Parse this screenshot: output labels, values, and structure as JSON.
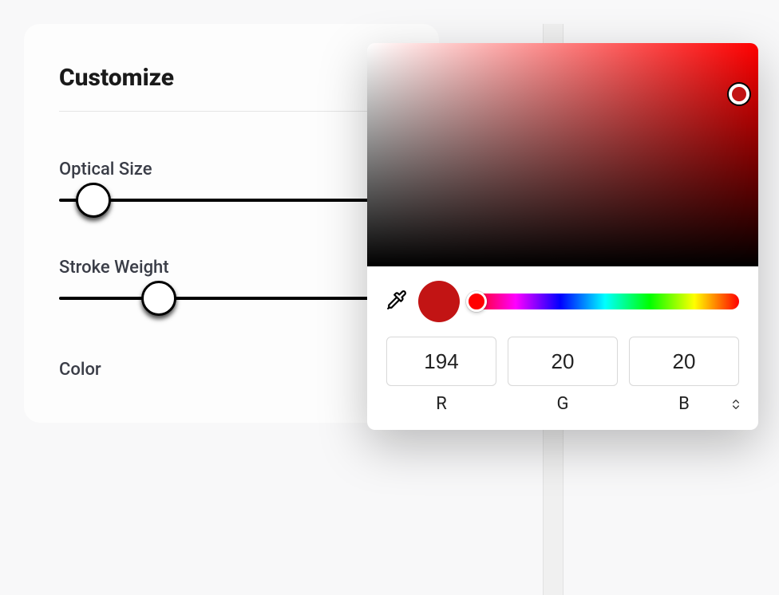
{
  "panel": {
    "title": "Customize",
    "optical_size_label": "Optical Size",
    "stroke_weight_label": "Stroke Weight",
    "color_label": "Color",
    "optical_size_percent": 10,
    "stroke_weight_percent": 29
  },
  "color_picker": {
    "swatch_hex": "#c21414",
    "r_value": "194",
    "g_value": "20",
    "b_value": "20",
    "r_label": "R",
    "g_label": "G",
    "b_label": "B"
  }
}
